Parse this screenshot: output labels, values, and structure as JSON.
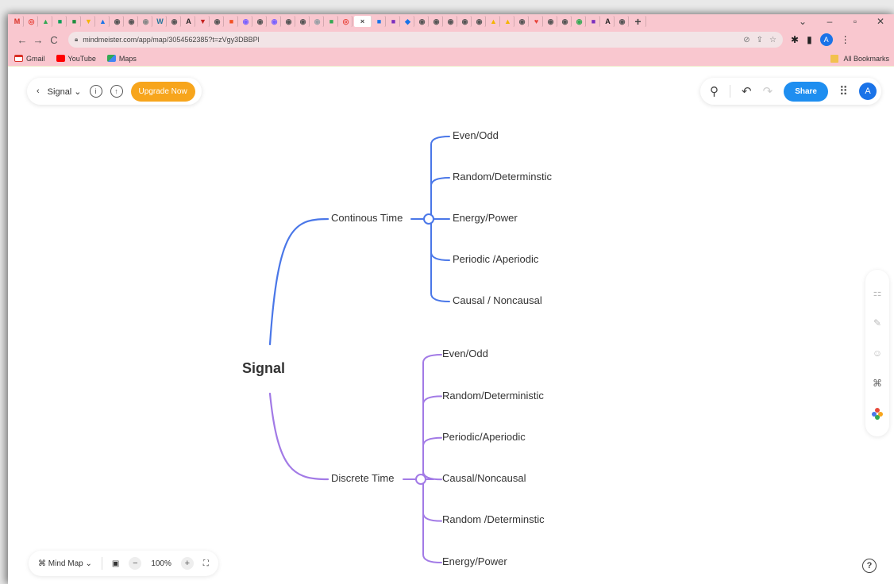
{
  "browser": {
    "url": "mindmeister.com/app/map/3054562385?t=zVgy3DBBPl",
    "bookmarks": [
      "Gmail",
      "YouTube",
      "Maps"
    ],
    "all_bookmarks": "All Bookmarks",
    "profile_initial": "A"
  },
  "header": {
    "map_title": "Signal",
    "upgrade_label": "Upgrade Now",
    "share_label": "Share",
    "avatar_initial": "A"
  },
  "mindmap": {
    "root": "Signal",
    "branches": [
      {
        "label": "Continous Time",
        "color": "#4a77e8",
        "children": [
          "Even/Odd",
          "Random/Determinstic",
          "Energy/Power",
          "Periodic /Aperiodic",
          "Causal / Noncausal"
        ]
      },
      {
        "label": "Discrete Time",
        "color": "#a27ae6",
        "children": [
          "Even/Odd",
          "Random/Deterministic",
          "Periodic/Aperiodic",
          "Causal/Noncausal",
          "Random /Determinstic",
          "Energy/Power"
        ]
      }
    ]
  },
  "footer": {
    "view_label": "Mind Map",
    "zoom_level": "100%"
  }
}
